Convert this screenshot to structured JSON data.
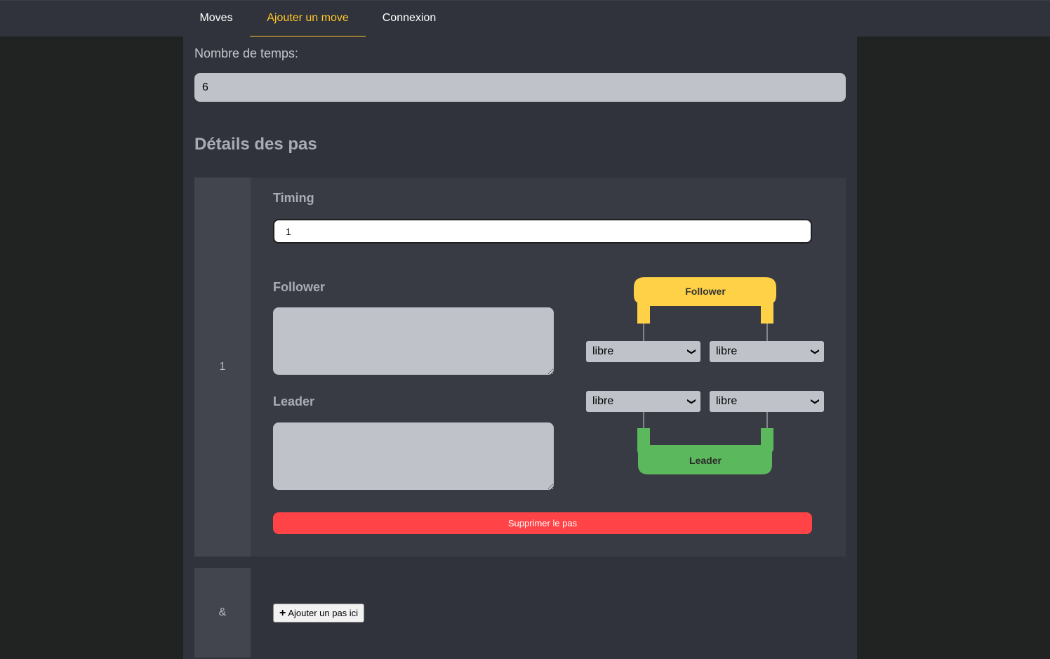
{
  "nav": {
    "items": [
      {
        "label": "Moves"
      },
      {
        "label": "Ajouter un move",
        "active": true
      },
      {
        "label": "Connexion"
      }
    ]
  },
  "form": {
    "temps_label": "Nombre de temps:",
    "temps_value": "6",
    "section_title": "Détails des pas"
  },
  "step": {
    "index": "1",
    "timing_label": "Timing",
    "timing_value": "1",
    "follower_label": "Follower",
    "leader_label": "Leader",
    "diagram_follower": "Follower",
    "diagram_leader": "Leader",
    "follower_left": "libre",
    "follower_right": "libre",
    "leader_left": "libre",
    "leader_right": "libre",
    "delete_label": "Supprimer le pas"
  },
  "next_step": {
    "index": "&",
    "add_label": "Ajouter un pas ici",
    "add_icon": "plus-icon"
  },
  "colors": {
    "accent": "#ffc62b",
    "follower": "#ffd147",
    "leader": "#5cb85c",
    "danger": "#ff4346"
  }
}
